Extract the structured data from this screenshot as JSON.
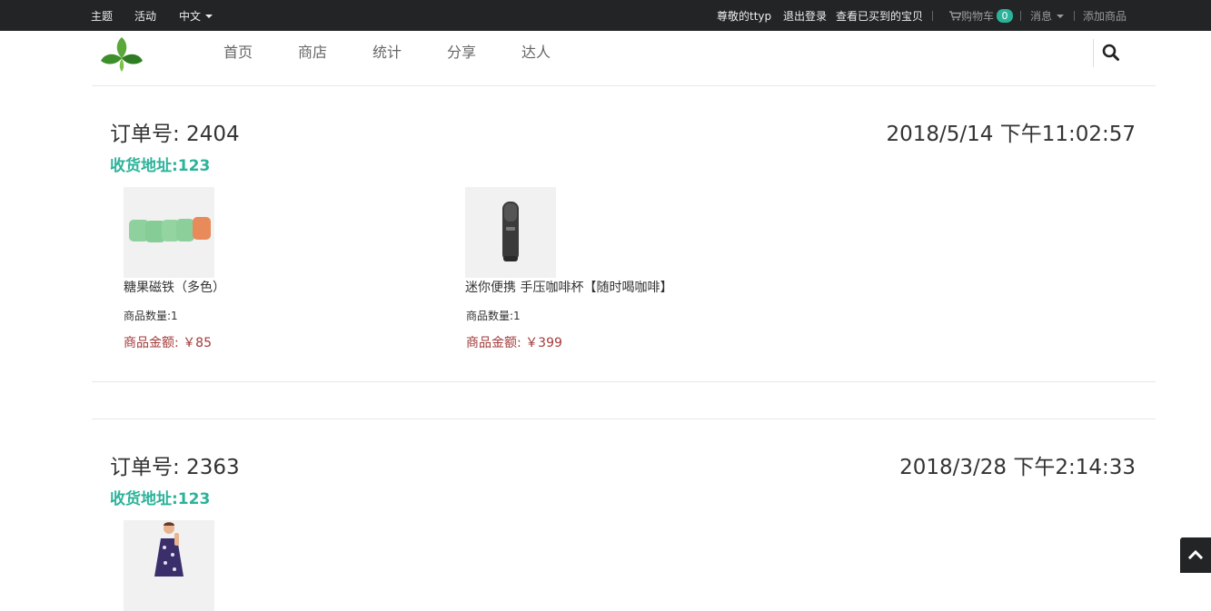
{
  "topbar": {
    "left": [
      "主题",
      "活动",
      "中文"
    ],
    "greeting": "尊敬的ttyp",
    "logout": "退出登录",
    "purchased": "查看已买到的宝贝",
    "cart_label": "购物车",
    "cart_count": "0",
    "messages": "消息",
    "add_product": "添加商品"
  },
  "nav": {
    "items": [
      "首页",
      "商店",
      "统计",
      "分享",
      "达人"
    ]
  },
  "orders": [
    {
      "title": "订单号: 2404",
      "time": "2018/5/14 下午11:02:57",
      "address": "收货地址:123",
      "items": [
        {
          "name": "糖果磁铁（多色）",
          "qty": "商品数量:1",
          "price": "商品金额: ￥85",
          "image_icon": "candy-magnets-image"
        },
        {
          "name": "迷你便携 手压咖啡杯【随时喝咖啡】",
          "qty": "商品数量:1",
          "price": "商品金额: ￥399",
          "image_icon": "coffee-maker-image"
        }
      ]
    },
    {
      "title": "订单号: 2363",
      "time": "2018/3/28 下午2:14:33",
      "address": "收货地址:123",
      "items": [
        {
          "image_icon": "child-dress-image"
        }
      ]
    }
  ],
  "colors": {
    "topbar_bg": "#222426",
    "accent": "#2bb39a",
    "price": "#a33a3a"
  }
}
